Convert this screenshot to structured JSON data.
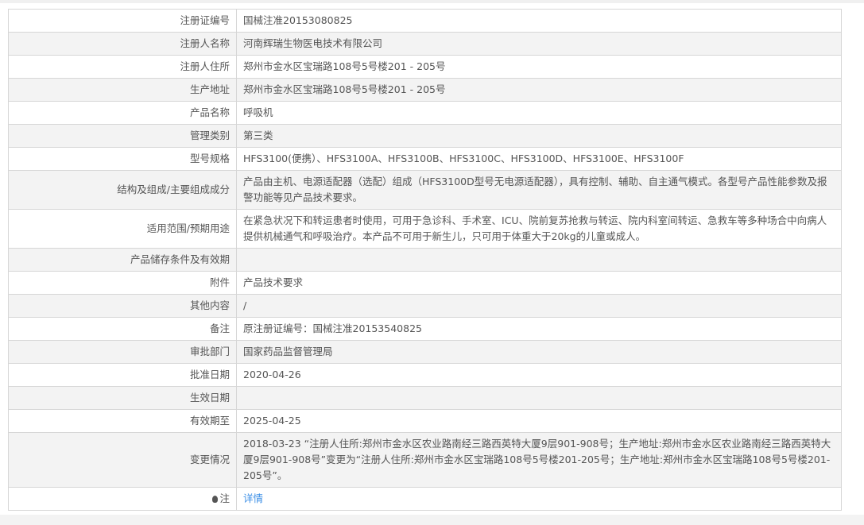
{
  "rows": [
    {
      "label": "注册证编号",
      "value": "国械注准20153080825"
    },
    {
      "label": "注册人名称",
      "value": "河南辉瑞生物医电技术有限公司"
    },
    {
      "label": "注册人住所",
      "value": "郑州市金水区宝瑞路108号5号楼201 - 205号"
    },
    {
      "label": "生产地址",
      "value": "郑州市金水区宝瑞路108号5号楼201 - 205号"
    },
    {
      "label": "产品名称",
      "value": "呼吸机"
    },
    {
      "label": "管理类别",
      "value": "第三类"
    },
    {
      "label": "型号规格",
      "value": "HFS3100(便携）、HFS3100A、HFS3100B、HFS3100C、HFS3100D、HFS3100E、HFS3100F"
    },
    {
      "label": "结构及组成/主要组成成分",
      "value": "产品由主机、电源适配器（选配）组成（HFS3100D型号无电源适配器），具有控制、辅助、自主通气模式。各型号产品性能参数及报警功能等见产品技术要求。"
    },
    {
      "label": "适用范围/预期用途",
      "value": "在紧急状况下和转运患者时使用，可用于急诊科、手术室、ICU、院前复苏抢救与转运、院内科室间转运、急救车等多种场合中向病人提供机械通气和呼吸治疗。本产品不可用于新生儿，只可用于体重大于20kg的儿童或成人。"
    },
    {
      "label": "产品储存条件及有效期",
      "value": ""
    },
    {
      "label": "附件",
      "value": "产品技术要求"
    },
    {
      "label": "其他内容",
      "value": "/"
    },
    {
      "label": "备注",
      "value": "原注册证编号：国械注准20153540825"
    },
    {
      "label": "审批部门",
      "value": "国家药品监督管理局"
    },
    {
      "label": "批准日期",
      "value": "2020-04-26"
    },
    {
      "label": "生效日期",
      "value": ""
    },
    {
      "label": "有效期至",
      "value": "2025-04-25"
    },
    {
      "label": "变更情况",
      "value": "2018-03-23 “注册人住所:郑州市金水区农业路南经三路西英特大厦9层901-908号；生产地址:郑州市金水区农业路南经三路西英特大厦9层901-908号”变更为“注册人住所:郑州市金水区宝瑞路108号5号楼201-205号；生产地址:郑州市金水区宝瑞路108号5号楼201-205号”。"
    }
  ],
  "note": {
    "label": "注",
    "link": "详情"
  }
}
